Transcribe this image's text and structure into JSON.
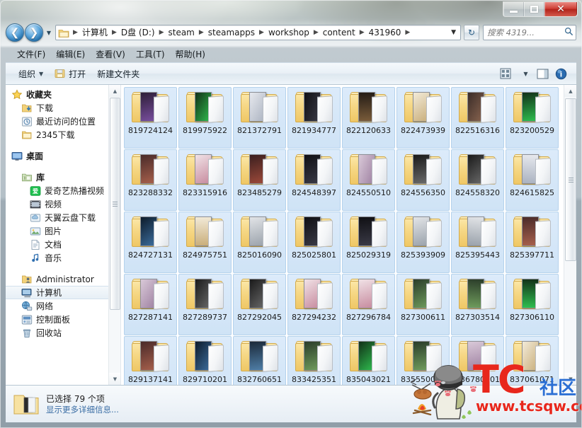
{
  "window": {
    "minimize_label": "",
    "maximize_label": "",
    "close_label": "✕"
  },
  "address": {
    "back_label": "❮",
    "forward_label": "❯",
    "history_caret": "▼",
    "crumb_separator": "▶",
    "dropdown_caret": "▼",
    "refresh_label": "↻",
    "breadcrumbs": [
      "计算机",
      "D盘 (D:)",
      "steam",
      "steamapps",
      "workshop",
      "content",
      "431960"
    ]
  },
  "search": {
    "placeholder": "搜索 4319...",
    "icon": "search-icon"
  },
  "menu": {
    "items": [
      "文件(F)",
      "编辑(E)",
      "查看(V)",
      "工具(T)",
      "帮助(H)"
    ]
  },
  "toolbar": {
    "organize_label": "组织",
    "organize_caret": "▼",
    "open_label": "打开",
    "new_folder_label": "新建文件夹",
    "view_caret": "▼",
    "icons": [
      "view-options-icon",
      "preview-pane-icon",
      "help-icon"
    ]
  },
  "sidebar": {
    "groups": [
      {
        "name": "favorites",
        "header": {
          "label": "收藏夹",
          "icon": "star-icon",
          "indent": 0
        },
        "items": [
          {
            "label": "下载",
            "icon": "downloads-icon",
            "indent": 1
          },
          {
            "label": "最近访问的位置",
            "icon": "recent-places-icon",
            "indent": 1
          },
          {
            "label": "2345下载",
            "icon": "folder-icon",
            "indent": 1
          }
        ]
      },
      {
        "name": "desktop",
        "header": {
          "label": "桌面",
          "icon": "desktop-icon",
          "indent": 0
        },
        "items": []
      },
      {
        "name": "libraries",
        "header": {
          "label": "库",
          "icon": "library-icon",
          "indent": 1
        },
        "items": [
          {
            "label": "爱奇艺热播视频",
            "icon": "iqiyi-icon",
            "indent": 2
          },
          {
            "label": "视频",
            "icon": "videos-icon",
            "indent": 2
          },
          {
            "label": "天翼云盘下载",
            "icon": "cloud-disk-icon",
            "indent": 2
          },
          {
            "label": "图片",
            "icon": "pictures-icon",
            "indent": 2
          },
          {
            "label": "文档",
            "icon": "documents-icon",
            "indent": 2
          },
          {
            "label": "音乐",
            "icon": "music-icon",
            "indent": 2
          }
        ]
      },
      {
        "name": "system",
        "header": null,
        "items": [
          {
            "label": "Administrator",
            "icon": "user-folder-icon",
            "indent": 1,
            "selected": false
          },
          {
            "label": "计算机",
            "icon": "computer-icon",
            "indent": 1,
            "selected": true
          },
          {
            "label": "网络",
            "icon": "network-icon",
            "indent": 1,
            "selected": false
          },
          {
            "label": "控制面板",
            "icon": "control-panel-icon",
            "indent": 1,
            "selected": false
          },
          {
            "label": "回收站",
            "icon": "recycle-bin-icon",
            "indent": 1,
            "selected": false
          }
        ]
      }
    ]
  },
  "files": {
    "items": [
      "819724124",
      "819975922",
      "821372791",
      "821934777",
      "822120633",
      "822473939",
      "822516316",
      "823200529",
      "823288332",
      "823315916",
      "823485279",
      "824548397",
      "824550510",
      "824556350",
      "824558320",
      "824615825",
      "824727131",
      "824975751",
      "825016090",
      "825025801",
      "825029319",
      "825393909",
      "825395443",
      "825397711",
      "827287141",
      "827289737",
      "827292045",
      "827294232",
      "827296784",
      "827300611",
      "827303514",
      "827306110",
      "829137141",
      "829710201",
      "832760651",
      "833425351",
      "835043021",
      "835550000",
      "836780401",
      "837061071"
    ]
  },
  "statusbar": {
    "line1": "已选择 79 个项",
    "line2": "显示更多详细信息...",
    "icon": "folder-icon"
  },
  "watermark": {
    "brand": "TC",
    "brand_suffix": "社区",
    "url": "www.tcsqw.com"
  },
  "colors": {
    "selection_fill": "#d4e6f8",
    "selection_border": "#b5d2ec",
    "close_button": "#cf4137",
    "link_blue": "#3b6ea5",
    "watermark_red": "#e8271c",
    "watermark_blue": "#2b6fd4"
  }
}
